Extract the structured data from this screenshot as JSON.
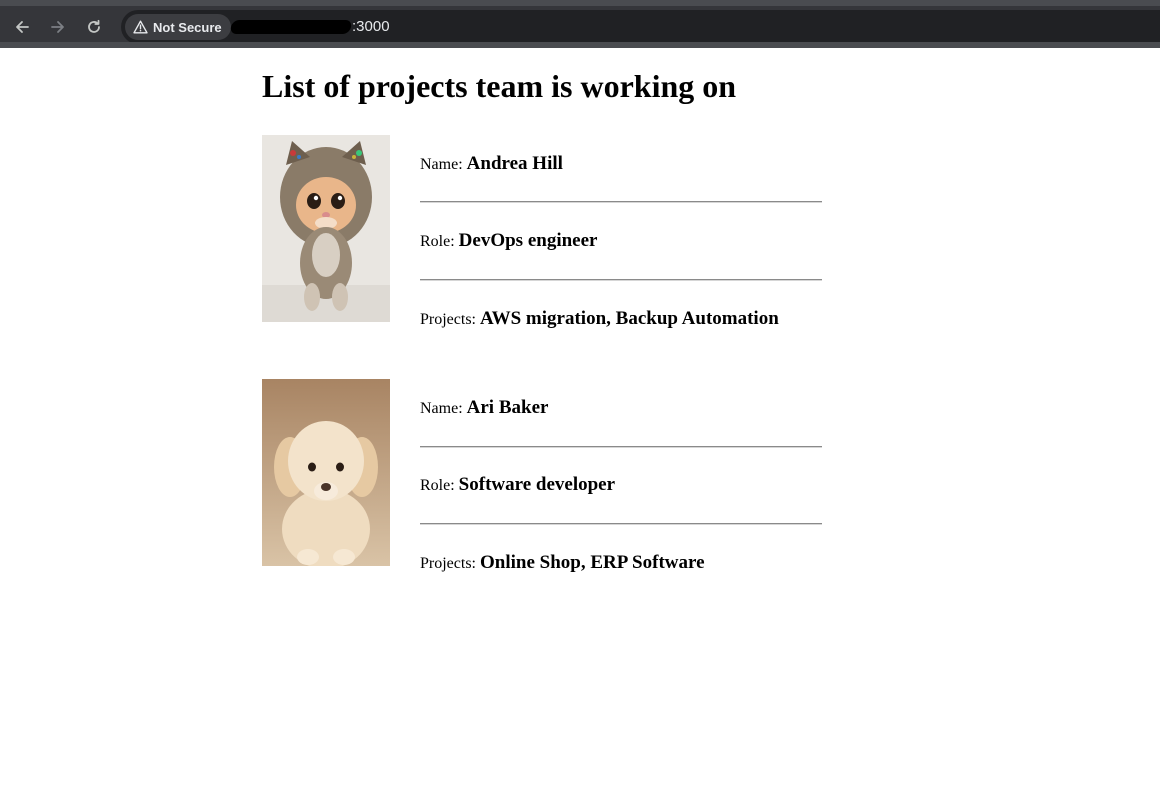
{
  "browser": {
    "security_label": "Not Secure",
    "url_visible": ":3000"
  },
  "page": {
    "title": "List of projects team is working on"
  },
  "labels": {
    "name": "Name:",
    "role": "Role:",
    "projects": "Projects:"
  },
  "members": [
    {
      "photo": "kitten-in-hat-photo",
      "name": "Andrea Hill",
      "role": "DevOps engineer",
      "projects": "AWS migration, Backup Automation"
    },
    {
      "photo": "puppy-photo",
      "name": "Ari Baker",
      "role": "Software developer",
      "projects": "Online Shop, ERP Software"
    }
  ],
  "colors": {
    "chrome": "#35363a",
    "omnibox": "#202124",
    "divider": "#8a8a8a"
  }
}
